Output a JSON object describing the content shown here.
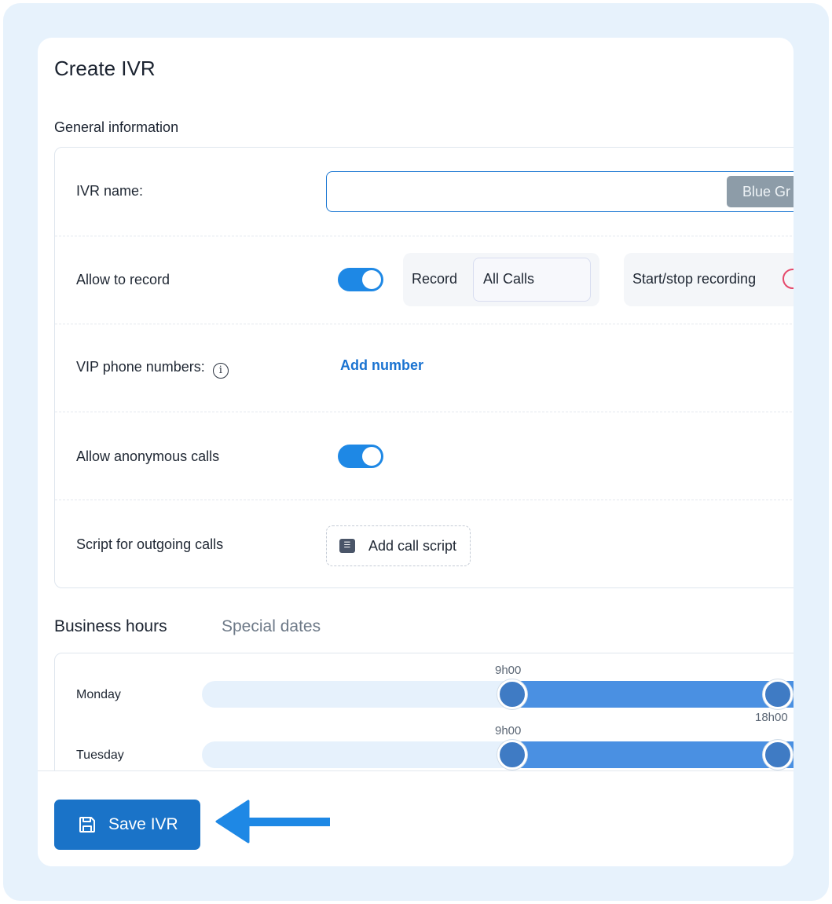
{
  "page": {
    "title": "Create IVR",
    "section_general": "General information"
  },
  "form": {
    "ivr_name": {
      "label": "IVR name:",
      "value": "",
      "chip": "Blue Gr"
    },
    "record": {
      "label": "Allow to record",
      "toggle_on": true,
      "record_label": "Record",
      "record_value": "All Calls",
      "start_stop_label": "Start/stop recording"
    },
    "vip": {
      "label": "VIP phone numbers:",
      "info_icon": "info-icon",
      "add_label": "Add number"
    },
    "anonymous": {
      "label": "Allow anonymous calls",
      "toggle_on": true
    },
    "script": {
      "label": "Script for outgoing calls",
      "button_label": "Add call script",
      "icon": "checklist-icon"
    }
  },
  "tabs": [
    {
      "label": "Business hours",
      "active": true
    },
    {
      "label": "Special dates",
      "active": false
    }
  ],
  "hours": [
    {
      "day": "Monday",
      "start": "9h00",
      "end": "18h00"
    },
    {
      "day": "Tuesday",
      "start": "9h00",
      "end": ""
    }
  ],
  "footer": {
    "save_label": "Save IVR",
    "save_icon": "floppy-disk-icon"
  },
  "colors": {
    "accent": "#1a73c8",
    "toggle": "#1e88e5",
    "range": "#4a90e2",
    "record_indicator": "#e5496b",
    "arrow": "#1e88e5"
  }
}
